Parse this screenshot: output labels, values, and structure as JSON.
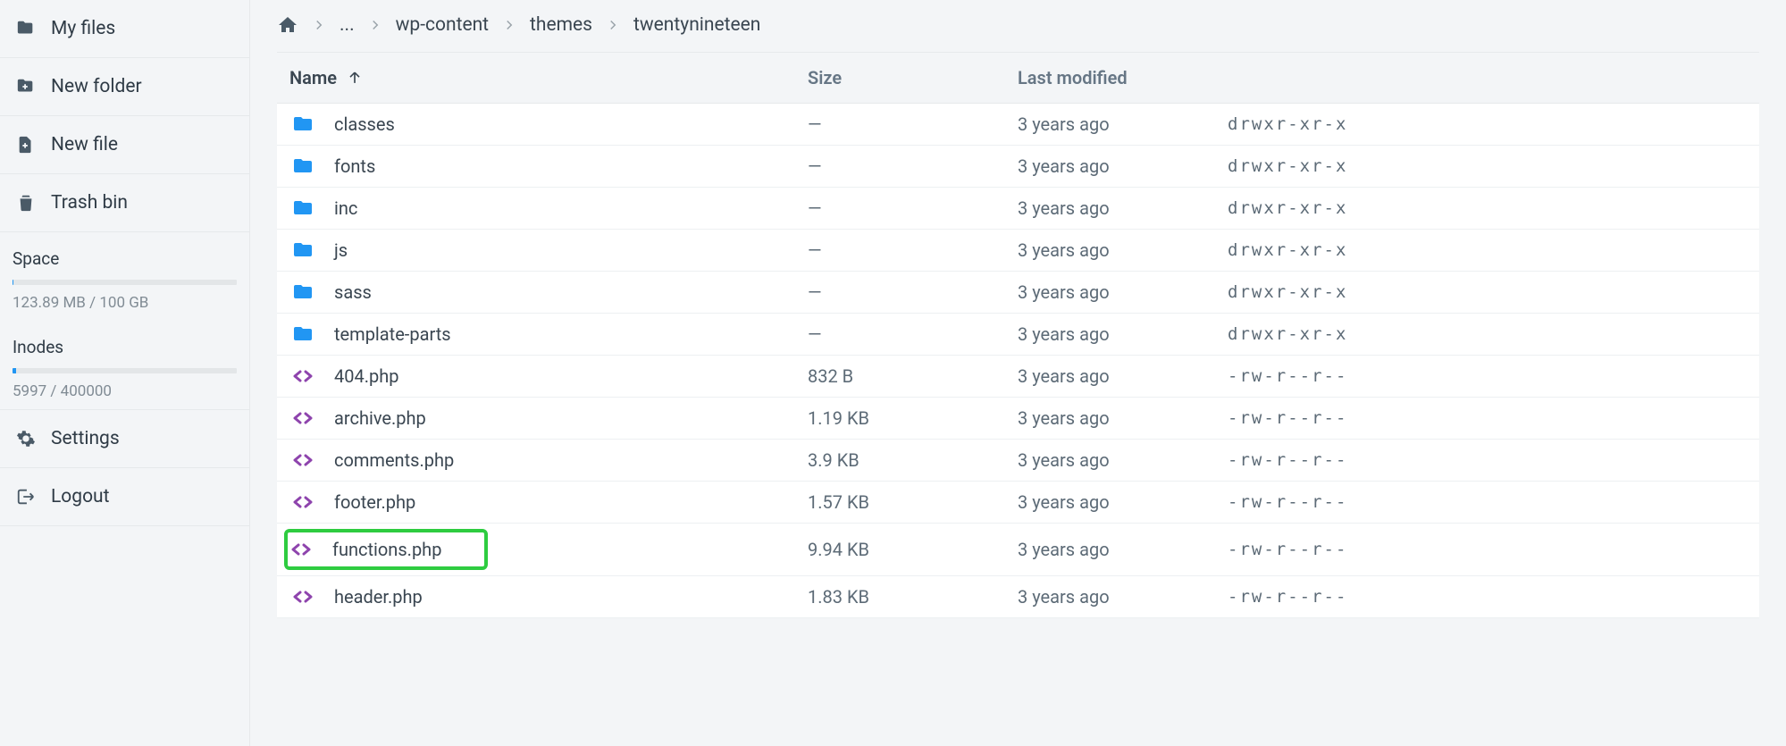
{
  "sidebar": {
    "nav": [
      {
        "label": "My files",
        "icon": "folder"
      },
      {
        "label": "New folder",
        "icon": "folder-plus"
      },
      {
        "label": "New file",
        "icon": "file-plus"
      },
      {
        "label": "Trash bin",
        "icon": "trash"
      }
    ],
    "space": {
      "title": "Space",
      "text": "123.89 MB / 100 GB",
      "percent": 0.2
    },
    "inodes": {
      "title": "Inodes",
      "text": "5997 / 400000",
      "percent": 1.5
    },
    "bottom": [
      {
        "label": "Settings",
        "icon": "gear"
      },
      {
        "label": "Logout",
        "icon": "logout"
      }
    ]
  },
  "breadcrumbs": {
    "ellipsis": "...",
    "items": [
      "wp-content",
      "themes",
      "twentynineteen"
    ]
  },
  "table": {
    "headers": {
      "name": "Name",
      "size": "Size",
      "modified": "Last modified"
    },
    "rows": [
      {
        "type": "folder",
        "name": "classes",
        "size": "—",
        "modified": "3 years ago",
        "perm": "drwxr-xr-x",
        "hl": false
      },
      {
        "type": "folder",
        "name": "fonts",
        "size": "—",
        "modified": "3 years ago",
        "perm": "drwxr-xr-x",
        "hl": false
      },
      {
        "type": "folder",
        "name": "inc",
        "size": "—",
        "modified": "3 years ago",
        "perm": "drwxr-xr-x",
        "hl": false
      },
      {
        "type": "folder",
        "name": "js",
        "size": "—",
        "modified": "3 years ago",
        "perm": "drwxr-xr-x",
        "hl": false
      },
      {
        "type": "folder",
        "name": "sass",
        "size": "—",
        "modified": "3 years ago",
        "perm": "drwxr-xr-x",
        "hl": false
      },
      {
        "type": "folder",
        "name": "template-parts",
        "size": "—",
        "modified": "3 years ago",
        "perm": "drwxr-xr-x",
        "hl": false
      },
      {
        "type": "code",
        "name": "404.php",
        "size": "832 B",
        "modified": "3 years ago",
        "perm": "-rw-r--r--",
        "hl": false
      },
      {
        "type": "code",
        "name": "archive.php",
        "size": "1.19 KB",
        "modified": "3 years ago",
        "perm": "-rw-r--r--",
        "hl": false
      },
      {
        "type": "code",
        "name": "comments.php",
        "size": "3.9 KB",
        "modified": "3 years ago",
        "perm": "-rw-r--r--",
        "hl": false
      },
      {
        "type": "code",
        "name": "footer.php",
        "size": "1.57 KB",
        "modified": "3 years ago",
        "perm": "-rw-r--r--",
        "hl": false
      },
      {
        "type": "code",
        "name": "functions.php",
        "size": "9.94 KB",
        "modified": "3 years ago",
        "perm": "-rw-r--r--",
        "hl": true
      },
      {
        "type": "code",
        "name": "header.php",
        "size": "1.83 KB",
        "modified": "3 years ago",
        "perm": "-rw-r--r--",
        "hl": false
      }
    ]
  }
}
